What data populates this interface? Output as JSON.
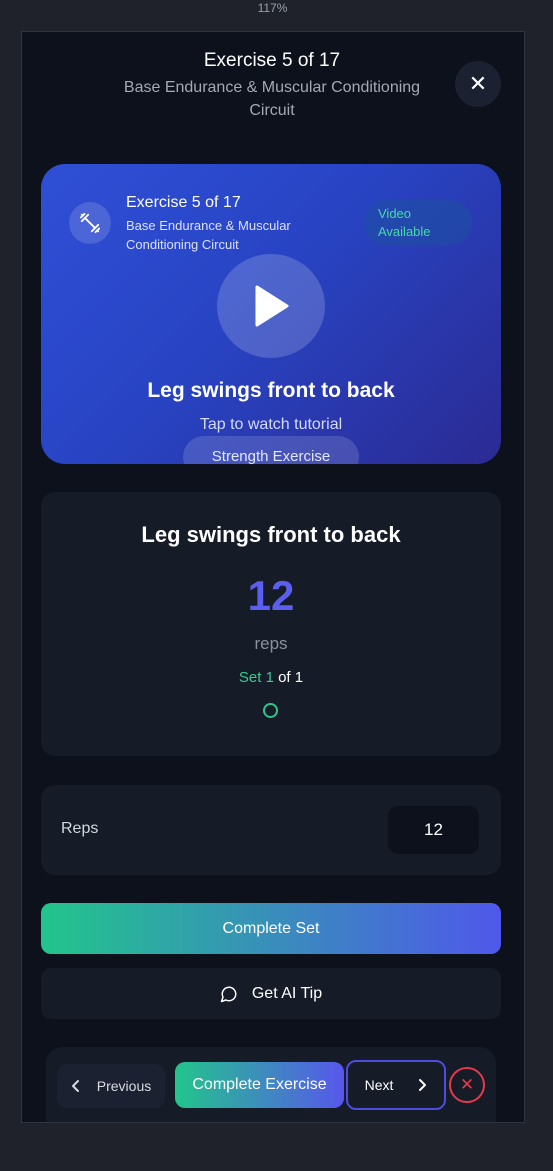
{
  "browser": {
    "zoom": "117%"
  },
  "header": {
    "title": "Exercise 5 of 17",
    "subtitle": "Base Endurance & Muscular Conditioning Circuit",
    "close_icon": "close-icon"
  },
  "video_card": {
    "exercise_counter": "Exercise 5 of 17",
    "workout_name": "Base Endurance & Muscular Conditioning Circuit",
    "badge": "Video Available",
    "exercise_name": "Leg swings front to back",
    "tap_text": "Tap to watch tutorial",
    "type_pill": "Strength Exercise",
    "icons": [
      "dumbbell-icon",
      "play-icon"
    ]
  },
  "exercise_info": {
    "name": "Leg swings front to back",
    "reps": "12",
    "reps_unit": "reps",
    "set_label": "Set",
    "set_current": "1",
    "set_of": "of",
    "set_total": "1"
  },
  "reps_input": {
    "label": "Reps",
    "value": "12"
  },
  "actions": {
    "complete_set": "Complete Set",
    "ai_tip": "Get AI Tip",
    "ai_tip_icon": "chat-bubble-icon"
  },
  "bottom_nav": {
    "previous": "Previous",
    "complete_exercise": "Complete Exercise",
    "next": "Next",
    "icons": [
      "chevron-left-icon",
      "chevron-right-icon",
      "x-icon"
    ]
  },
  "colors": {
    "accent_green": "#22c58b",
    "accent_indigo": "#5b5ff0",
    "danger": "#e33b4b",
    "panel": "#151b27",
    "background": "#0c111b"
  }
}
